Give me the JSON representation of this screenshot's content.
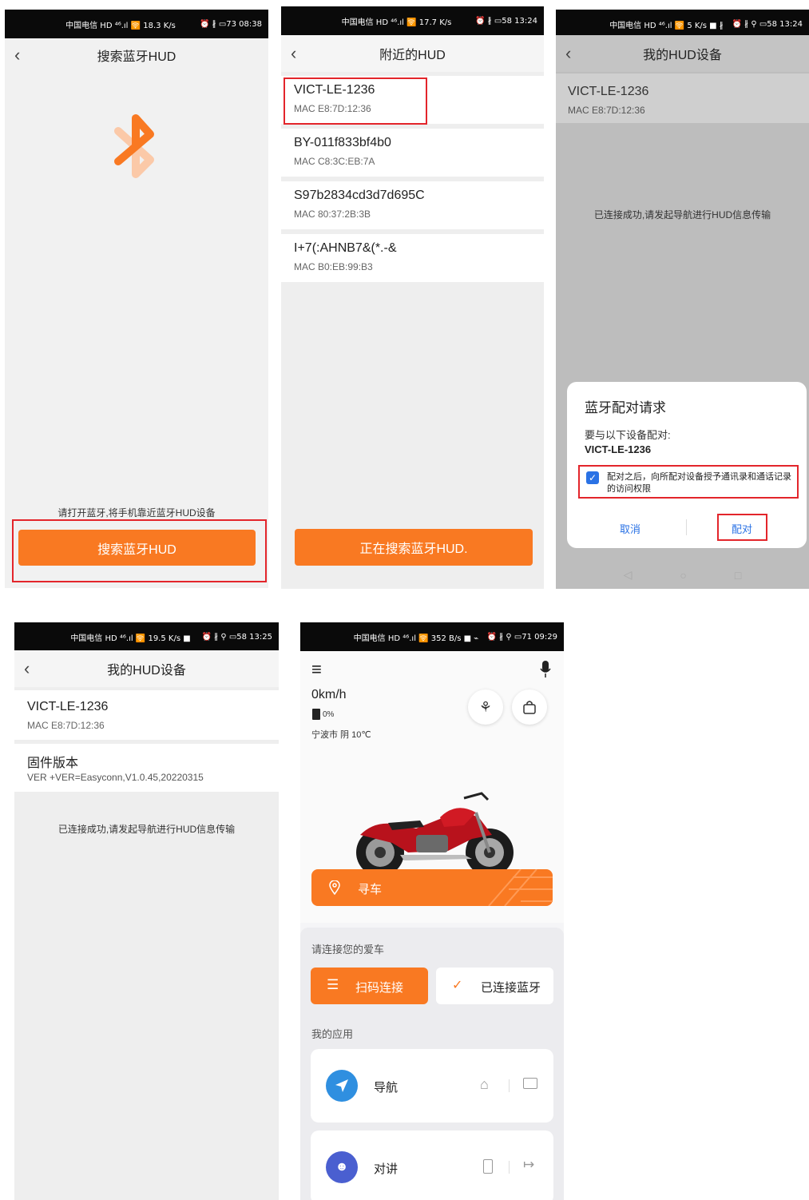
{
  "screen1": {
    "status": {
      "carrier": "中国电信 HD ⁴⁶.ıl 🛜 18.3 K/s",
      "right": "⏰ ∦ ▭73 08:38"
    },
    "title": "搜索蓝牙HUD",
    "hint": "请打开蓝牙,将手机靠近蓝牙HUD设备",
    "button": "搜索蓝牙HUD",
    "accent": "#f97922"
  },
  "screen2": {
    "status": {
      "carrier": "中国电信 HD ⁴⁶.ıl 🛜 17.7 K/s",
      "right": "⏰ ∦ ▭58 13:24"
    },
    "title": "附近的HUD",
    "devices": [
      {
        "name": "VICT-LE-1236",
        "mac": "MAC E8:7D:12:36"
      },
      {
        "name": "BY-011f833bf4b0",
        "mac": "MAC C8:3C:EB:7A"
      },
      {
        "name": "S97b2834cd3d7d695C",
        "mac": "MAC 80:37:2B:3B"
      },
      {
        "name": "I+7(:AHNB7&(*.-&",
        "mac": "MAC B0:EB:99:B3"
      }
    ],
    "button": "正在搜索蓝牙HUD."
  },
  "screen3": {
    "status": {
      "carrier": "中国电信 HD ⁴⁶.ıl 🛜 5 K/s ■ ∦",
      "right": "⏰ ∦ ⚲ ▭58 13:24"
    },
    "title": "我的HUD设备",
    "device": {
      "name": "VICT-LE-1236",
      "mac": "MAC E8:7D:12:36"
    },
    "message": "已连接成功,请发起导航进行HUD信息传输",
    "dialog": {
      "title": "蓝牙配对请求",
      "line1": "要与以下设备配对:",
      "device": "VICT-LE-1236",
      "checkbox_text": "配对之后，向所配对设备授予通讯录和通话记录的访问权限",
      "cancel": "取消",
      "pair": "配对"
    }
  },
  "screen4": {
    "status": {
      "carrier": "中国电信 HD ⁴⁶.ıl 🛜 19.5 K/s ■",
      "right": "⏰ ∦ ⚲ ▭58 13:25"
    },
    "title": "我的HUD设备",
    "device": {
      "name": "VICT-LE-1236",
      "mac": "MAC E8:7D:12:36"
    },
    "firmware_label": "固件版本",
    "firmware_value": "VER +VER=Easyconn,V1.0.45,20220315",
    "message": "已连接成功,请发起导航进行HUD信息传输"
  },
  "screen5": {
    "status": {
      "carrier": "中国电信 HD ⁴⁶.ıl 🛜 352 B/s ■ ⌁",
      "right": "⏰ ∦ ⚲ ▭71 09:29"
    },
    "speed": "0km/h",
    "fuel": "0%",
    "weather": "宁波市 阴 10℃",
    "find_car": "寻车",
    "connect_prompt": "请连接您的爱车",
    "scan_connect": "扫码连接",
    "bt_connected": "已连接蓝牙",
    "my_apps": "我的应用",
    "apps": [
      {
        "label": "导航"
      },
      {
        "label": "对讲"
      }
    ]
  }
}
